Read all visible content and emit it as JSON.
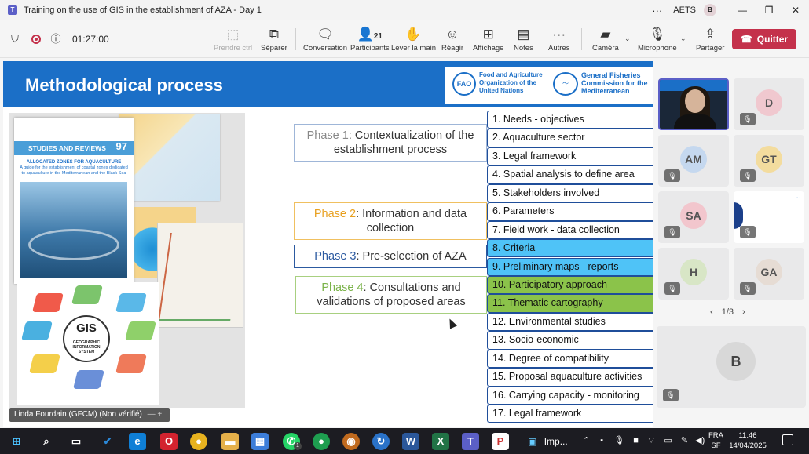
{
  "window": {
    "title": "Training on the use of GIS in the establishment of AZA - Day 1",
    "more": "···",
    "user_label": "AETS",
    "user_avatar": "B",
    "controls": {
      "minimize": "—",
      "maximize": "❐",
      "close": "✕"
    }
  },
  "toolbar": {
    "timer": "01:27:00",
    "buttons": [
      {
        "label": "Prendre ctrl",
        "icon": "take-control-icon",
        "disabled": true
      },
      {
        "label": "Séparer",
        "icon": "pop-out-icon"
      },
      {
        "label": "Conversation",
        "icon": "chat-icon"
      },
      {
        "label": "Participants",
        "icon": "people-icon",
        "count": "21"
      },
      {
        "label": "Lever la main",
        "icon": "raise-hand-icon"
      },
      {
        "label": "Réagir",
        "icon": "react-icon"
      },
      {
        "label": "Affichage",
        "icon": "view-icon"
      },
      {
        "label": "Notes",
        "icon": "notes-icon"
      },
      {
        "label": "Autres",
        "icon": "more-icon"
      },
      {
        "label": "Caméra",
        "icon": "camera-off-icon"
      },
      {
        "label": "Microphone",
        "icon": "mic-off-icon"
      },
      {
        "label": "Partager",
        "icon": "share-icon"
      }
    ],
    "leave_label": "Quitter"
  },
  "slide": {
    "title": "Methodological process",
    "fao_text": "Food and Agriculture Organization of the United Nations",
    "gfcm_text": "General Fisheries Commission for the Mediterranean",
    "cover": {
      "band": "STUDIES AND REVIEWS",
      "number": "97",
      "subtitle": "ALLOCATED ZONES FOR AQUACULTURE",
      "subtitle2": "A guide for the establishment of coastal zones dedicated to aquaculture in the Mediterranean and the Black Sea"
    },
    "gis_label": "GIS",
    "gis_sub": "GEOGRAPHIC INFORMATION SYSTEM",
    "phases": [
      {
        "num": "Phase 1",
        "text": ": Contextualization of the establishment process"
      },
      {
        "num": "Phase 2",
        "text": ": Information and data collection"
      },
      {
        "num": "Phase 3",
        "text": ": Pre-selection of AZA"
      },
      {
        "num": "Phase 4",
        "text": ": Consultations and validations of proposed areas"
      }
    ],
    "steps": [
      "1. Needs - objectives",
      "2. Aquaculture sector",
      "3. Legal framework",
      "4. Spatial analysis to define area",
      "5. Stakeholders involved",
      "6. Parameters",
      "7. Field work - data collection",
      "8. Criteria",
      "9. Preliminary maps - reports",
      "10. Participatory approach",
      "11. Thematic cartography",
      "12. Environmental studies",
      "13. Socio-economic",
      "14. Degree of compatibility",
      "15. Proposal aquaculture activities",
      "16. Carrying capacity - monitoring",
      "17. Legal framework"
    ],
    "presenter": "Linda Fourdain (GFCM) (Non vérifié)",
    "presenter_controls": "—  +"
  },
  "participants": {
    "tiles": [
      "D",
      "AM",
      "GT",
      "SA",
      "H",
      "GA"
    ],
    "page": "1/3",
    "large": "B"
  },
  "taskbar": {
    "app_label": "Imp...",
    "lang1": "FRA",
    "lang2": "SF",
    "time": "11:46",
    "date": "14/04/2025",
    "badge": "1"
  },
  "colors": {
    "accent": "#5b5fc7",
    "leave": "#c4314b",
    "slide_header": "#1b6fc7",
    "phase2": "#e8a020",
    "phase3": "#2c5aa0",
    "phase4": "#7bb34a",
    "step_blue": "#4fc3f7",
    "step_green": "#8bc34a"
  }
}
